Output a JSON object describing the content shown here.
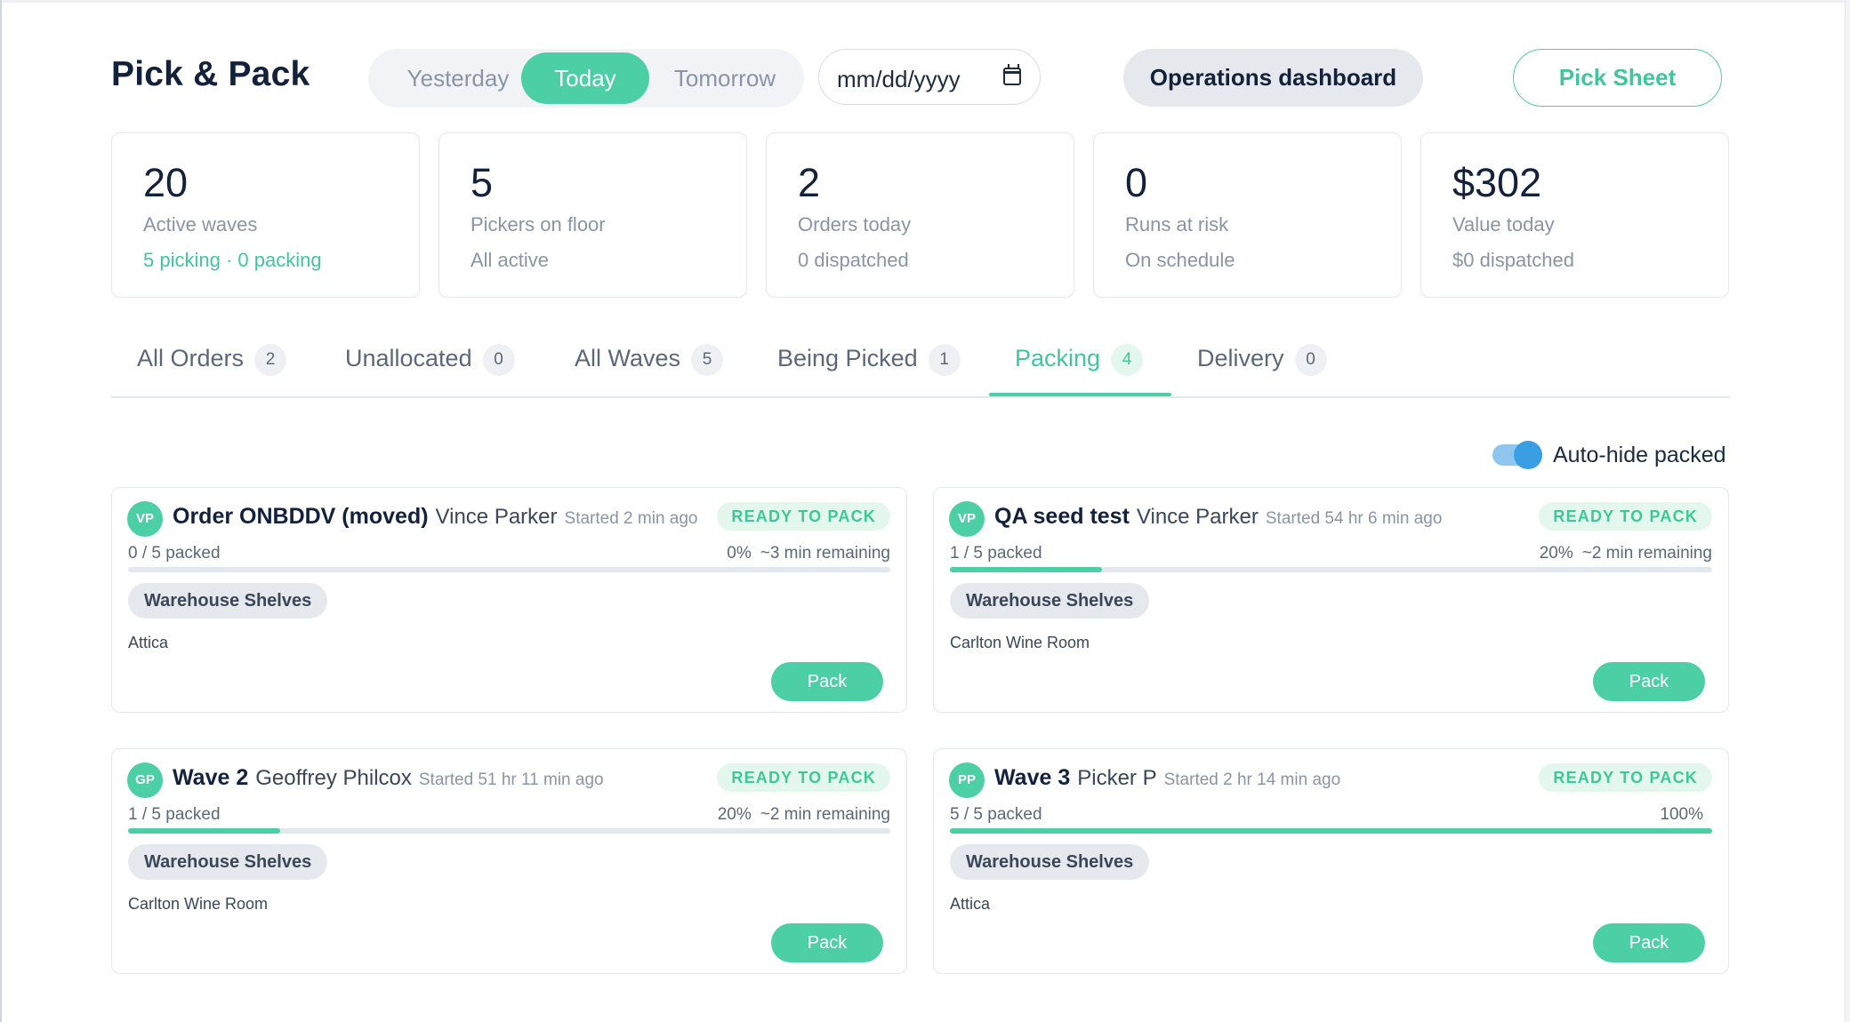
{
  "header": {
    "title": "Pick & Pack",
    "segment": [
      "Yesterday",
      "Today",
      "Tomorrow"
    ],
    "date_placeholder": "mm/dd/yyyy",
    "operations_label": "Operations dashboard",
    "pick_sheet_label": "Pick Sheet"
  },
  "stats": [
    {
      "value": "20",
      "label": "Active waves",
      "sub": "5 picking · 0 packing"
    },
    {
      "value": "5",
      "label": "Pickers on floor",
      "sub": "All active"
    },
    {
      "value": "2",
      "label": "Orders today",
      "sub": "0 dispatched"
    },
    {
      "value": "0",
      "label": "Runs at risk",
      "sub": "On schedule"
    },
    {
      "value": "$302",
      "label": "Value today",
      "sub": "$0 dispatched"
    }
  ],
  "tabs": [
    {
      "label": "All Orders",
      "count": "2"
    },
    {
      "label": "Unallocated",
      "count": "0"
    },
    {
      "label": "All Waves",
      "count": "5"
    },
    {
      "label": "Being Picked",
      "count": "1"
    },
    {
      "label": "Packing",
      "count": "4"
    },
    {
      "label": "Delivery",
      "count": "0"
    }
  ],
  "active_tab": "Packing",
  "toggle": {
    "label": "Auto-hide packed",
    "on": true
  },
  "cards": [
    {
      "initials": "VP",
      "title": "Order ONBDDV (moved)",
      "person": "Vince Parker",
      "started": "Started 2 min ago",
      "status": "READY TO PACK",
      "packed": "0 / 5 packed",
      "percent_label": "0%",
      "remaining": "~3 min remaining",
      "progress": 0,
      "location": "Warehouse Shelves",
      "venue": "Attica",
      "action": "Pack"
    },
    {
      "initials": "VP",
      "title": "QA seed test",
      "person": "Vince Parker",
      "started": "Started 54 hr 6 min ago",
      "status": "READY TO PACK",
      "packed": "1 / 5 packed",
      "percent_label": "20%",
      "remaining": "~2 min remaining",
      "progress": 0.2,
      "location": "Warehouse Shelves",
      "venue": "Carlton Wine Room",
      "action": "Pack"
    },
    {
      "initials": "GP",
      "title": "Wave 2",
      "person": "Geoffrey Philcox",
      "started": "Started 51 hr 11 min ago",
      "status": "READY TO PACK",
      "packed": "1 / 5 packed",
      "percent_label": "20%",
      "remaining": "~2 min remaining",
      "progress": 0.2,
      "location": "Warehouse Shelves",
      "venue": "Carlton Wine Room",
      "action": "Pack"
    },
    {
      "initials": "PP",
      "title": "Wave 3",
      "person": "Picker P",
      "started": "Started 2 hr 14 min ago",
      "status": "READY TO PACK",
      "packed": "5 / 5 packed",
      "percent_label": "100%",
      "remaining": "",
      "progress": 1,
      "location": "Warehouse Shelves",
      "venue": "Attica",
      "action": "Pack"
    }
  ],
  "colors": {
    "accent": "#4ccfa5",
    "accent_text": "#3fc79b",
    "toggle": "#3a9ee3",
    "text_dark": "#14213a",
    "text_muted": "#8a94a6"
  }
}
